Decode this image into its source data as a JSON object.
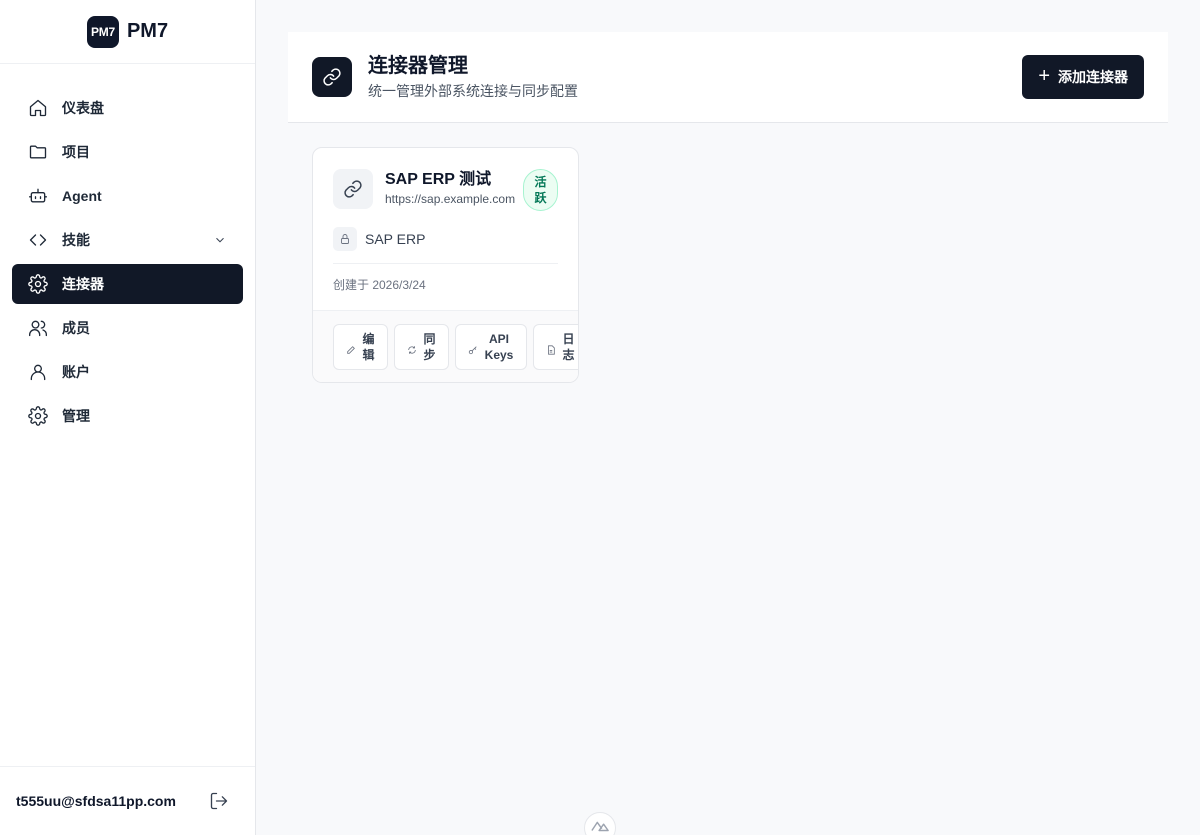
{
  "brand": {
    "logo": "PM7",
    "name": "PM7"
  },
  "nav": {
    "items": [
      {
        "label": "仪表盘",
        "icon": "home-icon"
      },
      {
        "label": "项目",
        "icon": "folder-icon"
      },
      {
        "label": "Agent",
        "icon": "bot-icon"
      },
      {
        "label": "技能",
        "icon": "code-icon"
      },
      {
        "label": "连接器",
        "icon": "gear-icon",
        "active": true
      },
      {
        "label": "成员",
        "icon": "users-icon"
      },
      {
        "label": "账户",
        "icon": "user-icon"
      },
      {
        "label": "管理",
        "icon": "gear-icon"
      }
    ]
  },
  "footer": {
    "email": "t555uu@sfdsa11pp.com"
  },
  "header": {
    "title": "连接器管理",
    "subtitle": "统一管理外部系统连接与同步配置",
    "add_label": "添加连接器"
  },
  "connector": {
    "name": "SAP ERP 测试",
    "url": "https://sap.example.com",
    "status": "活跃",
    "type": "SAP ERP",
    "created": "创建于 2026/3/24",
    "actions": {
      "edit": "编辑",
      "sync": "同步",
      "api_keys": "API Keys",
      "logs": "日志"
    }
  },
  "colors": {
    "primary": "#111827",
    "status_green": "#047857",
    "background": "#f8f9fb"
  }
}
